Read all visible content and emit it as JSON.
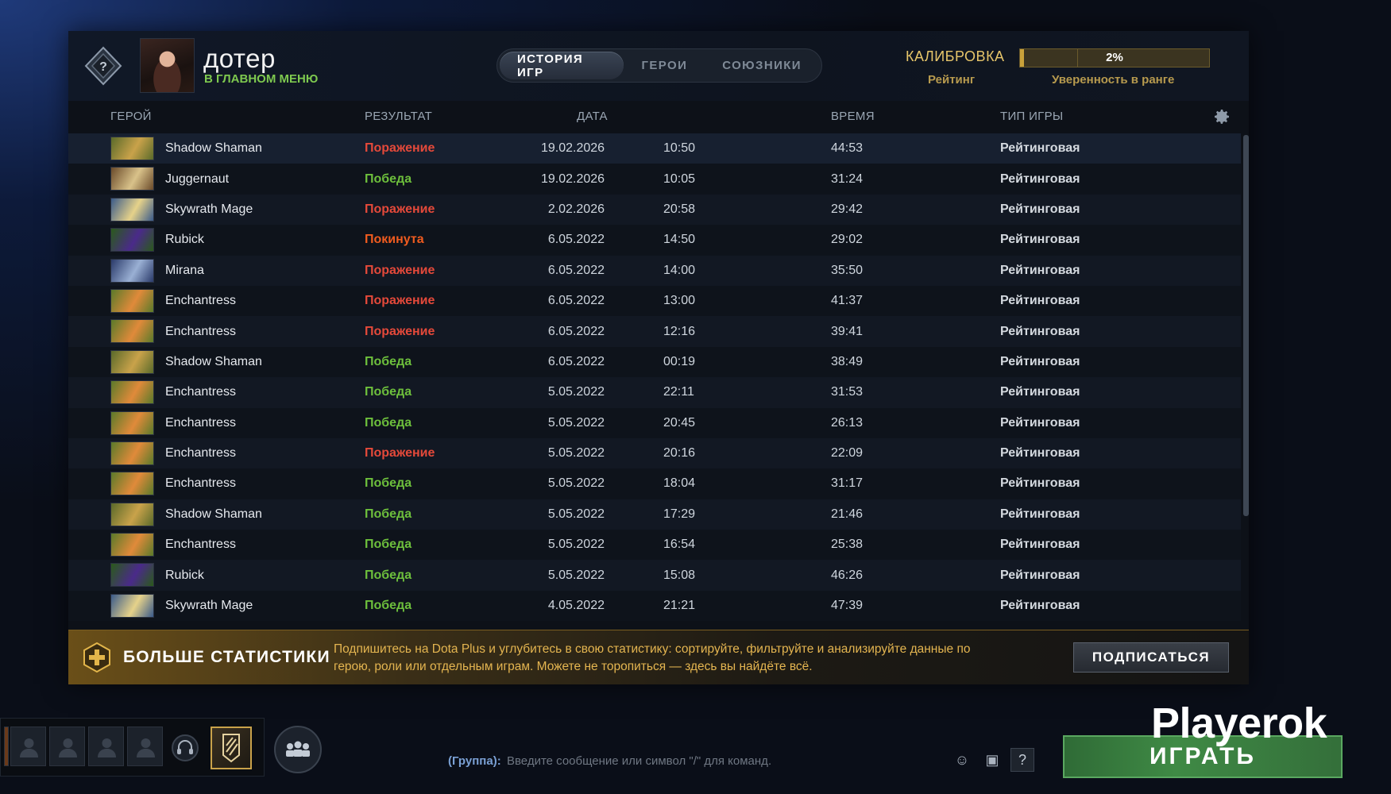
{
  "header": {
    "player_name": "дотер",
    "player_status": "В ГЛАВНОМ МЕНЮ",
    "tabs": [
      {
        "label": "ИСТОРИЯ ИГР",
        "active": true
      },
      {
        "label": "ГЕРОИ",
        "active": false
      },
      {
        "label": "СОЮЗНИКИ",
        "active": false
      }
    ],
    "calibration_label": "КАЛИБРОВКА",
    "rating_label": "Рейтинг",
    "confidence_percent_text": "2%",
    "confidence_fraction": 0.02,
    "confidence_label": "Уверенность в ранге"
  },
  "columns": {
    "hero": "ГЕРОЙ",
    "result": "РЕЗУЛЬТАТ",
    "date": "ДАТА",
    "duration": "ВРЕМЯ",
    "game_type": "ТИП ИГРЫ"
  },
  "matches": [
    {
      "hero": "Shadow Shaman",
      "icon": "shadow-shaman",
      "result": "Поражение",
      "result_kind": "loss",
      "date": "19.02.2026",
      "time": "10:50",
      "duration": "44:53",
      "game_type": "Рейтинговая"
    },
    {
      "hero": "Juggernaut",
      "icon": "juggernaut",
      "result": "Победа",
      "result_kind": "win",
      "date": "19.02.2026",
      "time": "10:05",
      "duration": "31:24",
      "game_type": "Рейтинговая"
    },
    {
      "hero": "Skywrath Mage",
      "icon": "skywrath-mage",
      "result": "Поражение",
      "result_kind": "loss",
      "date": "2.02.2026",
      "time": "20:58",
      "duration": "29:42",
      "game_type": "Рейтинговая"
    },
    {
      "hero": "Rubick",
      "icon": "rubick",
      "result": "Покинута",
      "result_kind": "aband",
      "date": "6.05.2022",
      "time": "14:50",
      "duration": "29:02",
      "game_type": "Рейтинговая"
    },
    {
      "hero": "Mirana",
      "icon": "mirana",
      "result": "Поражение",
      "result_kind": "loss",
      "date": "6.05.2022",
      "time": "14:00",
      "duration": "35:50",
      "game_type": "Рейтинговая"
    },
    {
      "hero": "Enchantress",
      "icon": "enchantress",
      "result": "Поражение",
      "result_kind": "loss",
      "date": "6.05.2022",
      "time": "13:00",
      "duration": "41:37",
      "game_type": "Рейтинговая"
    },
    {
      "hero": "Enchantress",
      "icon": "enchantress",
      "result": "Поражение",
      "result_kind": "loss",
      "date": "6.05.2022",
      "time": "12:16",
      "duration": "39:41",
      "game_type": "Рейтинговая"
    },
    {
      "hero": "Shadow Shaman",
      "icon": "shadow-shaman",
      "result": "Победа",
      "result_kind": "win",
      "date": "6.05.2022",
      "time": "00:19",
      "duration": "38:49",
      "game_type": "Рейтинговая"
    },
    {
      "hero": "Enchantress",
      "icon": "enchantress",
      "result": "Победа",
      "result_kind": "win",
      "date": "5.05.2022",
      "time": "22:11",
      "duration": "31:53",
      "game_type": "Рейтинговая"
    },
    {
      "hero": "Enchantress",
      "icon": "enchantress",
      "result": "Победа",
      "result_kind": "win",
      "date": "5.05.2022",
      "time": "20:45",
      "duration": "26:13",
      "game_type": "Рейтинговая"
    },
    {
      "hero": "Enchantress",
      "icon": "enchantress",
      "result": "Поражение",
      "result_kind": "loss",
      "date": "5.05.2022",
      "time": "20:16",
      "duration": "22:09",
      "game_type": "Рейтинговая"
    },
    {
      "hero": "Enchantress",
      "icon": "enchantress",
      "result": "Победа",
      "result_kind": "win",
      "date": "5.05.2022",
      "time": "18:04",
      "duration": "31:17",
      "game_type": "Рейтинговая"
    },
    {
      "hero": "Shadow Shaman",
      "icon": "shadow-shaman",
      "result": "Победа",
      "result_kind": "win",
      "date": "5.05.2022",
      "time": "17:29",
      "duration": "21:46",
      "game_type": "Рейтинговая"
    },
    {
      "hero": "Enchantress",
      "icon": "enchantress",
      "result": "Победа",
      "result_kind": "win",
      "date": "5.05.2022",
      "time": "16:54",
      "duration": "25:38",
      "game_type": "Рейтинговая"
    },
    {
      "hero": "Rubick",
      "icon": "rubick",
      "result": "Победа",
      "result_kind": "win",
      "date": "5.05.2022",
      "time": "15:08",
      "duration": "46:26",
      "game_type": "Рейтинговая"
    },
    {
      "hero": "Skywrath Mage",
      "icon": "skywrath-mage",
      "result": "Победа",
      "result_kind": "win",
      "date": "4.05.2022",
      "time": "21:21",
      "duration": "47:39",
      "game_type": "Рейтинговая"
    }
  ],
  "promo": {
    "title": "БОЛЬШЕ СТАТИСТИКИ",
    "text": "Подпишитесь на Dota Plus и углубитесь в свою статистику: сортируйте, фильтруйте и анализируйте данные по герою, роли или отдельным играм. Можете не торопиться — здесь вы найдёте всё.",
    "button": "ПОДПИСАТЬСЯ"
  },
  "chat": {
    "channel": "(Группа):",
    "placeholder": "Введите сообщение или символ \"/\" для команд.",
    "help": "?"
  },
  "play_button": "ИГРАТЬ",
  "watermark": "Playerok",
  "colors": {
    "win": "#6dbf3c",
    "loss": "#e4493a",
    "abandoned": "#ef5b1f",
    "accent_gold": "#e6c56a",
    "status_green": "#7ec94f"
  },
  "hero_icon_colors": {
    "shadow-shaman": [
      "#5a6a2a",
      "#c9a24a"
    ],
    "juggernaut": [
      "#6a4a2a",
      "#d9c28a"
    ],
    "skywrath-mage": [
      "#3a5a8a",
      "#e6d28a"
    ],
    "rubick": [
      "#2a5a1a",
      "#4a2a8a"
    ],
    "mirana": [
      "#2a3a6a",
      "#9ab0d4"
    ],
    "enchantress": [
      "#5a7a2a",
      "#e08a3a"
    ]
  }
}
